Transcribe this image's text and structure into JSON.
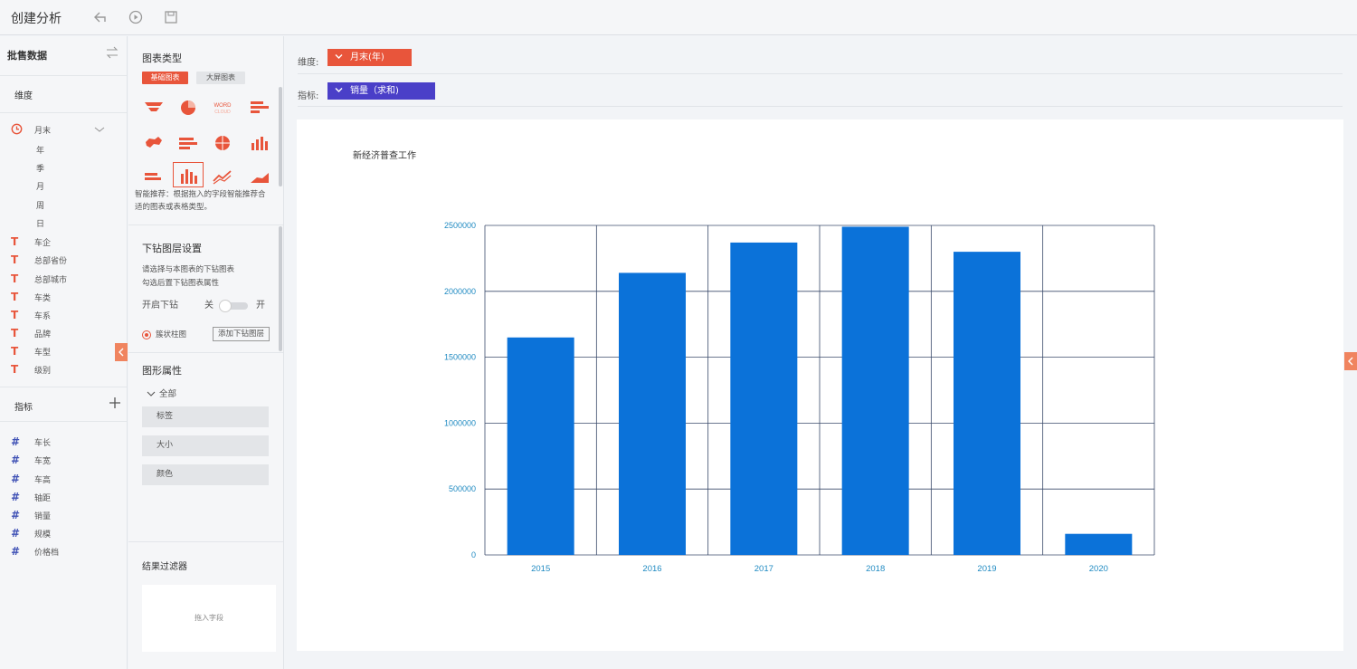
{
  "toolbar": {
    "title": "创建分析",
    "icons": [
      "undo-icon",
      "play-icon",
      "save-icon"
    ]
  },
  "left": {
    "dataset_title": "批售数据",
    "dimension_label": "维度",
    "time_field": "月末",
    "time_subs": [
      "年",
      "季",
      "月",
      "周",
      "日"
    ],
    "text_fields": [
      "车企",
      "总部省份",
      "总部城市",
      "车类",
      "车系",
      "品牌",
      "车型",
      "级别"
    ],
    "metric_label": "指标",
    "metric_fields": [
      "车长",
      "车宽",
      "车高",
      "轴距",
      "销量",
      "规模",
      "价格档"
    ]
  },
  "mid": {
    "chart_type_title": "图表类型",
    "tab_basic": "基础图表",
    "tab_bigscreen": "大屏图表",
    "recommend_text_1": "智能推荐：根据拖入的字段智能推荐合",
    "recommend_text_2": "适的图表或表格类型。",
    "drill_title": "下钻图层设置",
    "drill_desc_1": "请选择与本图表的下钻图表",
    "drill_desc_2": "勾选后置下钻图表属性",
    "drill_toggle_label": "开启下钻",
    "toggle_off": "关",
    "toggle_on": "开",
    "bar_option": "簇状柱图",
    "add_drill_layer": "添加下钻图层",
    "shape_props_title": "图形属性",
    "all_label": "全部",
    "attr_buttons": [
      "标签",
      "大小",
      "颜色"
    ],
    "filter_title": "结果过滤器",
    "filter_placeholder": "拖入字段"
  },
  "main": {
    "dimension_row_label": "维度:",
    "dimension_pill": "月末(年)",
    "metric_row_label": "指标:",
    "metric_pill": "销量（求和)",
    "chart_title": "新经济普查工作"
  },
  "colors": {
    "accent_red": "#e8553b",
    "accent_blue": "#4a3fc8",
    "bar_blue": "#0b72d9",
    "grid": "#3b4b6b",
    "tick_text": "#1f8ac2"
  },
  "chart_data": {
    "type": "bar",
    "title": "新经济普查工作",
    "categories": [
      "2015",
      "2016",
      "2017",
      "2018",
      "2019",
      "2020"
    ],
    "series": [
      {
        "values": [
          1650000,
          2140000,
          2370000,
          2490000,
          2300000,
          160000
        ]
      }
    ],
    "yticks": [
      "0",
      "500000",
      "1000000",
      "1500000",
      "2000000",
      "2500000"
    ],
    "ylim": [
      0,
      2500000
    ],
    "grid": true,
    "xlabel": "",
    "ylabel": ""
  }
}
